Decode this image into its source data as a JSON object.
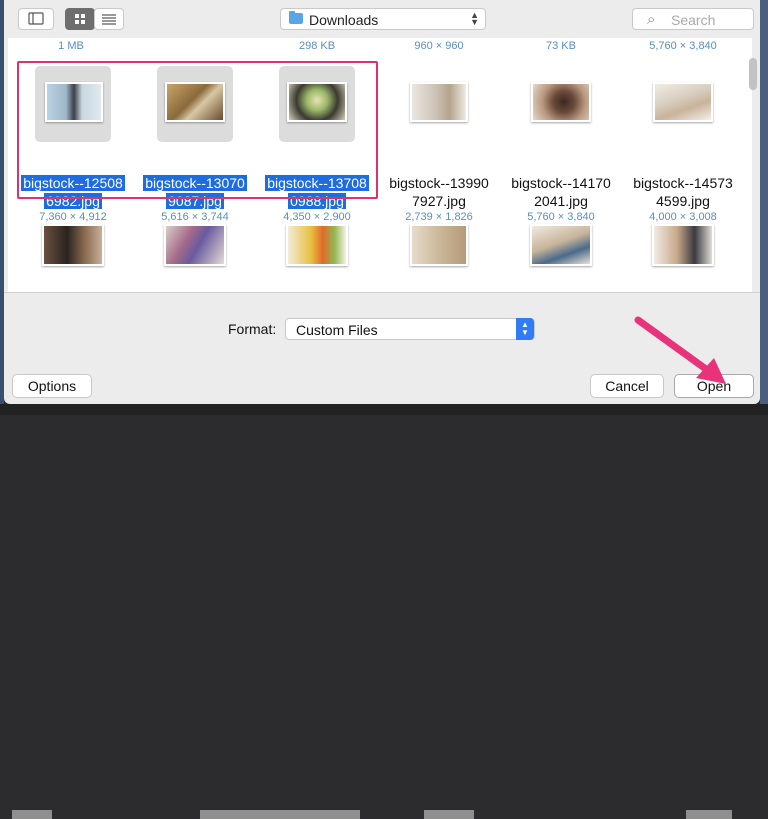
{
  "colors": {
    "selection": "#1d6ce0",
    "accent": "#2f7cf6",
    "annotation": "#e0306e"
  },
  "toolbar": {
    "sidebar_toggle_icon": "sidebar-icon",
    "icon_view_icon": "grid-icon",
    "list_view_icon": "list-icon",
    "location": "Downloads",
    "search_placeholder": "Search"
  },
  "previous_row": [
    "1 MB",
    "298 KB",
    "960 × 960",
    "73 KB",
    "5,760 × 3,840"
  ],
  "files": [
    {
      "name_line1": "bigstock--12508",
      "name_line2": "6982.jpg",
      "dims": "7,360 × 4,912",
      "selected": true
    },
    {
      "name_line1": "bigstock--13070",
      "name_line2": "9087.jpg",
      "dims": "5,616 × 3,744",
      "selected": true
    },
    {
      "name_line1": "bigstock--13708",
      "name_line2": "0988.jpg",
      "dims": "4,350 × 2,900",
      "selected": true
    },
    {
      "name_line1": "bigstock--13990",
      "name_line2": "7927.jpg",
      "dims": "2,739 × 1,826",
      "selected": false
    },
    {
      "name_line1": "bigstock--14170",
      "name_line2": "2041.jpg",
      "dims": "5,760 × 3,840",
      "selected": false
    },
    {
      "name_line1": "bigstock--14573",
      "name_line2": "4599.jpg",
      "dims": "4,000 × 3,008",
      "selected": false
    }
  ],
  "format": {
    "label": "Format:",
    "value": "Custom Files"
  },
  "buttons": {
    "options": "Options",
    "cancel": "Cancel",
    "open": "Open"
  }
}
